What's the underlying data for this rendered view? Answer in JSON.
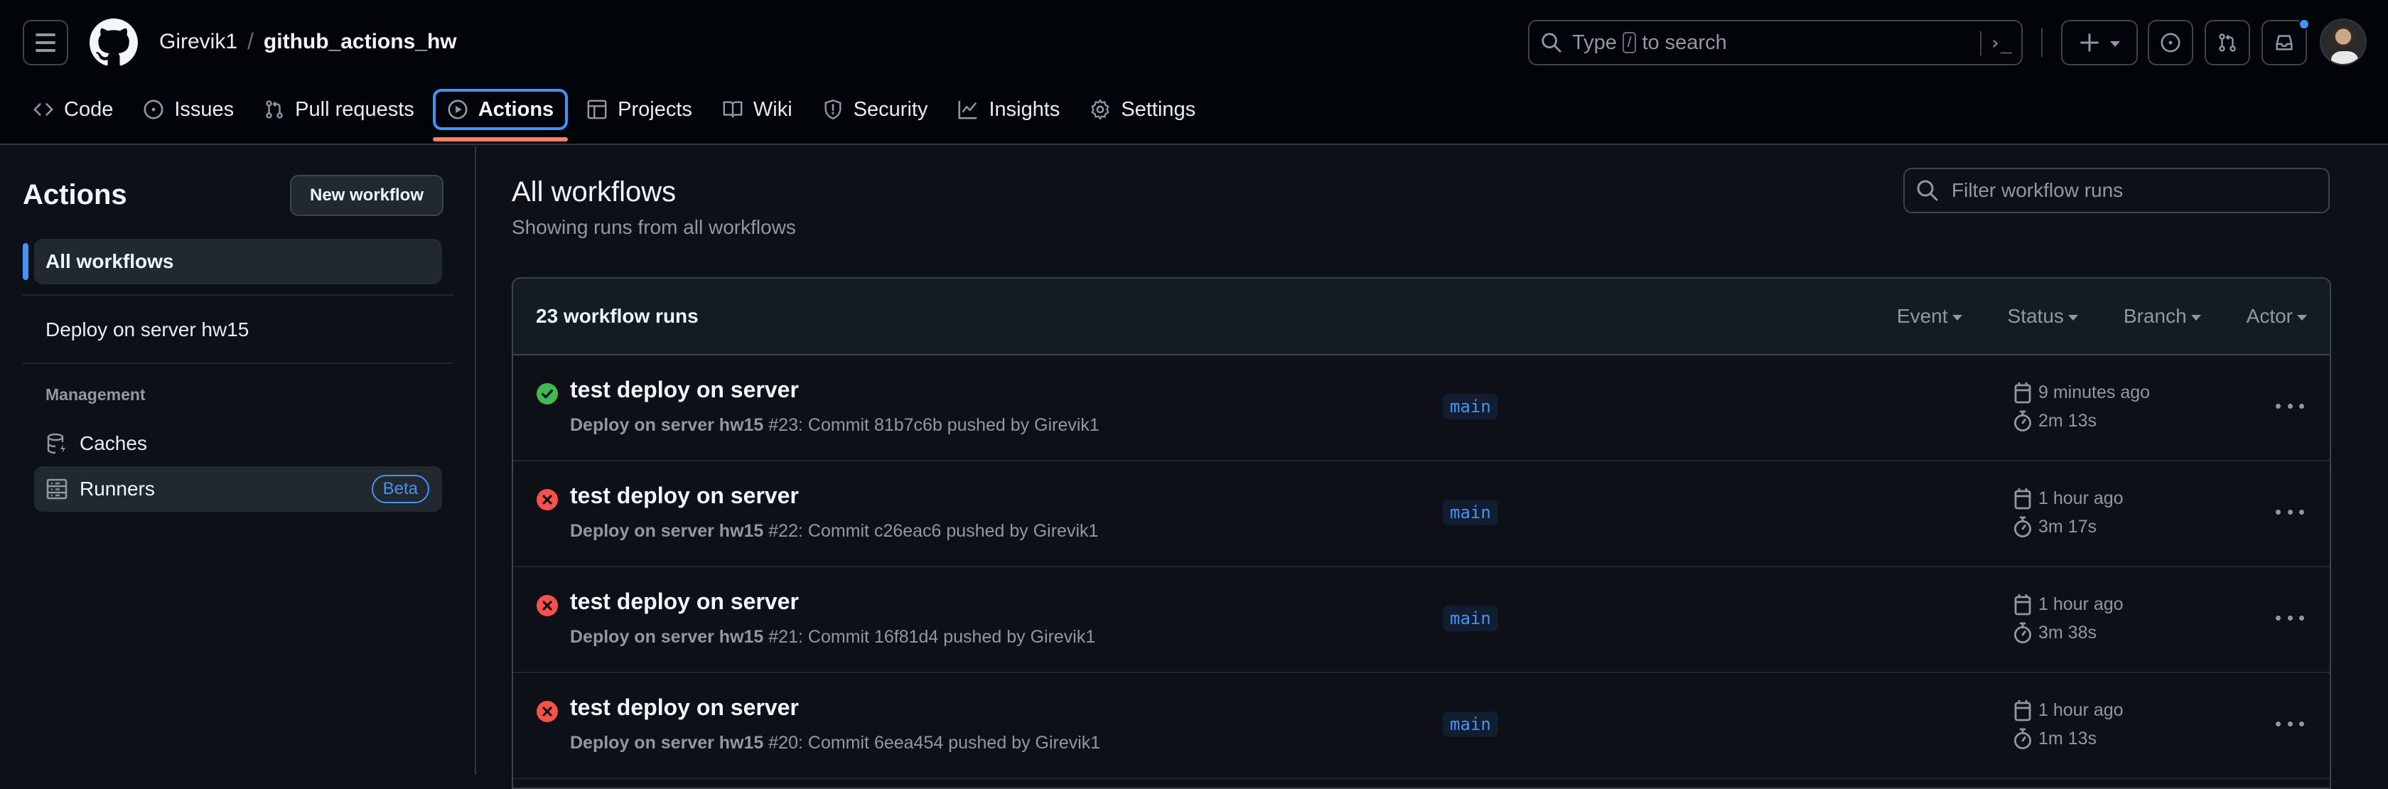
{
  "header": {
    "owner": "Girevik1",
    "separator": "/",
    "repo": "github_actions_hw",
    "search_placeholder_before": "Type",
    "search_key": "/",
    "search_placeholder_after": "to search",
    "command_palette_glyph": "›_",
    "notification_dot_color": "#4493f8"
  },
  "nav": {
    "tabs": [
      {
        "label": "Code",
        "icon": "code-icon"
      },
      {
        "label": "Issues",
        "icon": "issue-opened-icon"
      },
      {
        "label": "Pull requests",
        "icon": "git-pull-request-icon"
      },
      {
        "label": "Actions",
        "icon": "play-icon",
        "active": true
      },
      {
        "label": "Projects",
        "icon": "table-icon"
      },
      {
        "label": "Wiki",
        "icon": "book-icon"
      },
      {
        "label": "Security",
        "icon": "shield-icon"
      },
      {
        "label": "Insights",
        "icon": "graph-icon"
      },
      {
        "label": "Settings",
        "icon": "gear-icon"
      }
    ]
  },
  "sidebar": {
    "title": "Actions",
    "new_workflow_label": "New workflow",
    "items": [
      {
        "label": "All workflows",
        "active": true
      },
      {
        "label": "Deploy on server hw15"
      }
    ],
    "management_heading": "Management",
    "management_items": [
      {
        "label": "Caches",
        "icon": "cache-icon"
      },
      {
        "label": "Runners",
        "icon": "server-icon",
        "badge": "Beta"
      }
    ]
  },
  "main": {
    "title": "All workflows",
    "subtitle": "Showing runs from all workflows",
    "filter_placeholder": "Filter workflow runs",
    "runs_count": "23 workflow runs",
    "filters": [
      "Event",
      "Status",
      "Branch",
      "Actor"
    ],
    "colors": {
      "success": "#3fb950",
      "failure": "#f85149",
      "accent": "#4493f8",
      "active_underline": "#f78166"
    },
    "runs": [
      {
        "status": "success",
        "title": "test deploy on server",
        "workflow": "Deploy on server hw15",
        "detail": "#23: Commit 81b7c6b pushed by Girevik1",
        "branch": "main",
        "when": "9 minutes ago",
        "duration": "2m 13s"
      },
      {
        "status": "failure",
        "title": "test deploy on server",
        "workflow": "Deploy on server hw15",
        "detail": "#22: Commit c26eac6 pushed by Girevik1",
        "branch": "main",
        "when": "1 hour ago",
        "duration": "3m 17s"
      },
      {
        "status": "failure",
        "title": "test deploy on server",
        "workflow": "Deploy on server hw15",
        "detail": "#21: Commit 16f81d4 pushed by Girevik1",
        "branch": "main",
        "when": "1 hour ago",
        "duration": "3m 38s"
      },
      {
        "status": "failure",
        "title": "test deploy on server",
        "workflow": "Deploy on server hw15",
        "detail": "#20: Commit 6eea454 pushed by Girevik1",
        "branch": "main",
        "when": "1 hour ago",
        "duration": "1m 13s"
      }
    ]
  }
}
